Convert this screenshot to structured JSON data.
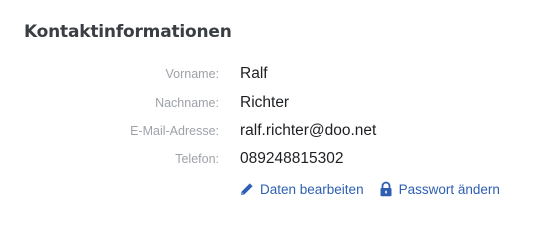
{
  "section": {
    "title": "Kontaktinformationen"
  },
  "fields": [
    {
      "label": "Vorname:",
      "value": "Ralf"
    },
    {
      "label": "Nachname:",
      "value": "Richter"
    },
    {
      "label": "E-Mail-Adresse:",
      "value": "ralf.richter@doo.net"
    },
    {
      "label": "Telefon:",
      "value": "089248815302"
    }
  ],
  "actions": {
    "edit_label": "Daten bearbeiten",
    "edit_icon": "pencil-icon",
    "password_label": "Passwort ändern",
    "password_icon": "lock-icon"
  },
  "colors": {
    "link": "#2e5fb3",
    "label": "#9ea2a8",
    "value": "#1d1f22",
    "title": "#3a3d42"
  }
}
